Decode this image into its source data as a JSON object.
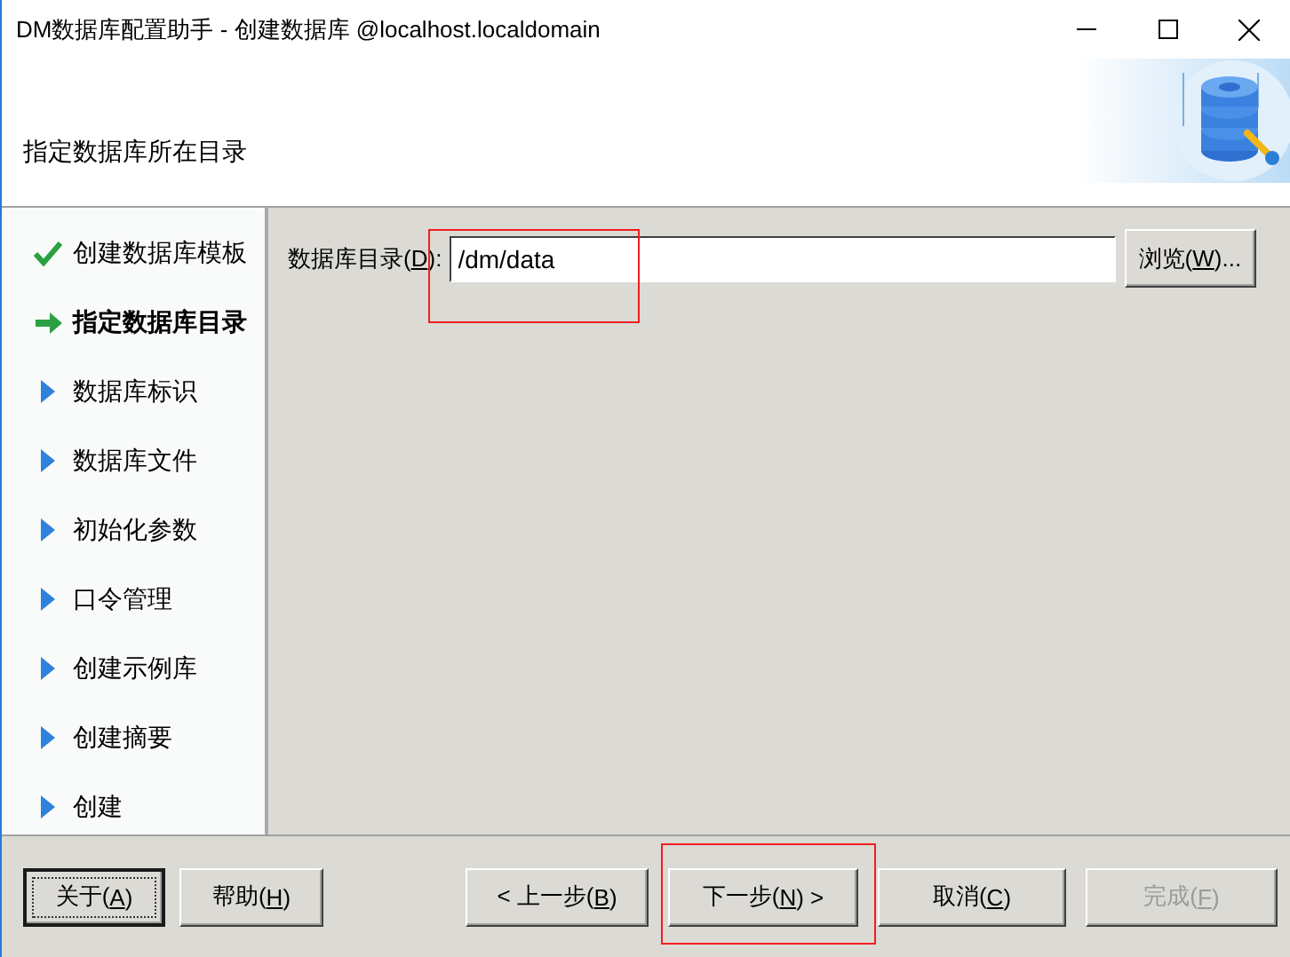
{
  "window": {
    "title": "DM数据库配置助手 - 创建数据库 @localhost.localdomain"
  },
  "header": {
    "title": "指定数据库所在目录"
  },
  "steps": [
    {
      "label": "创建数据库模板",
      "done": true,
      "selected": false
    },
    {
      "label": "指定数据库目录",
      "done": false,
      "selected": true
    },
    {
      "label": "数据库标识",
      "done": false,
      "selected": false
    },
    {
      "label": "数据库文件",
      "done": false,
      "selected": false
    },
    {
      "label": "初始化参数",
      "done": false,
      "selected": false
    },
    {
      "label": "口令管理",
      "done": false,
      "selected": false
    },
    {
      "label": "创建示例库",
      "done": false,
      "selected": false
    },
    {
      "label": "创建摘要",
      "done": false,
      "selected": false
    },
    {
      "label": "创建",
      "done": false,
      "selected": false
    }
  ],
  "directory": {
    "label_before": "数据库目录(",
    "label_key": "D",
    "label_after": "):",
    "value": "/dm/data",
    "highlighted": true
  },
  "browse_button": {
    "before": "浏览(",
    "key": "W",
    "after": ")..."
  },
  "left_buttons": [
    {
      "before": "关于(",
      "key": "A",
      "after": ")",
      "focused": true,
      "disabled": false,
      "highlighted": false
    },
    {
      "before": "帮助(",
      "key": "H",
      "after": ")",
      "focused": false,
      "disabled": false,
      "highlighted": false
    }
  ],
  "right_buttons": [
    {
      "before": "< 上一步(",
      "key": "B",
      "after": ")",
      "focused": false,
      "disabled": false,
      "highlighted": false
    },
    {
      "before": "下一步(",
      "key": "N",
      "after": ") >",
      "focused": false,
      "disabled": false,
      "highlighted": true
    },
    {
      "before": "取消(",
      "key": "C",
      "after": ")",
      "focused": false,
      "disabled": false,
      "highlighted": false
    },
    {
      "before": "完成(",
      "key": "F",
      "after": ")",
      "focused": false,
      "disabled": true,
      "highlighted": false
    }
  ]
}
